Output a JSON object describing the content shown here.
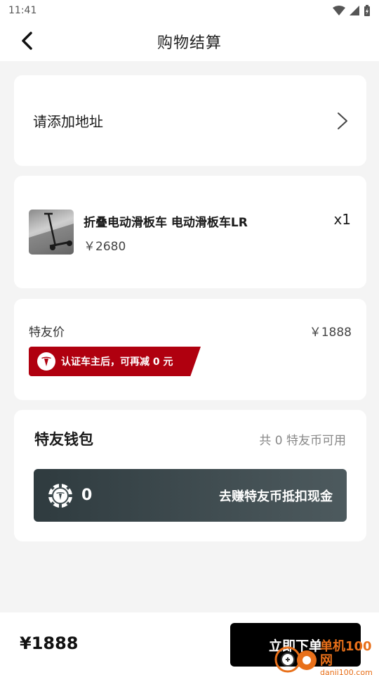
{
  "status_bar": {
    "time": "11:41"
  },
  "header": {
    "title": "购物结算"
  },
  "address": {
    "label": "请添加地址"
  },
  "product": {
    "name": "折叠电动滑板车 电动滑板车LR",
    "quantity": "x1",
    "price": "￥2680"
  },
  "pricing": {
    "label": "特友价",
    "value": "￥1888",
    "badge_text": "认证车主后，可再减 0 元"
  },
  "wallet": {
    "title": "特友钱包",
    "available": "共 0 特友币可用",
    "coin_count": "0",
    "earn_label": "去赚特友币抵扣现金"
  },
  "footer": {
    "total": "¥1888",
    "order_button": "立即下单"
  },
  "watermark": {
    "cn": "单机100网",
    "en": "danji100.com"
  },
  "colors": {
    "accent_red": "#b0000f",
    "button_black": "#000000",
    "coin_bar": "#3a474b"
  }
}
